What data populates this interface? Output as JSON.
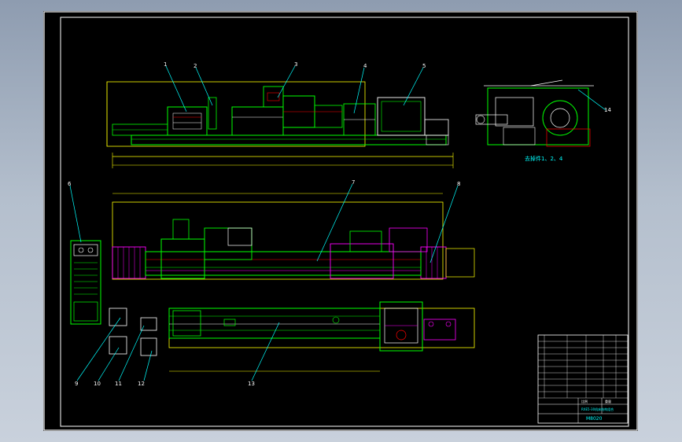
{
  "colors": {
    "background": "#000000",
    "border": "#ffffff",
    "outline": "#ffff00",
    "structure": "#00ff00",
    "secondary": "#ff00ff",
    "leader": "#00ffff",
    "detail": "#ff0000",
    "annotation": "#ffffff"
  },
  "callouts": {
    "c1": "1",
    "c2": "2",
    "c3": "3",
    "c4": "4",
    "c5": "5",
    "c6": "6",
    "c7": "7",
    "c8": "8",
    "c9": "9",
    "c10": "10",
    "c11": "11",
    "c12": "12",
    "c13": "13",
    "c14": "14"
  },
  "side_view_caption": "去掉件1、2、4",
  "title_block": {
    "drawing_number": "M8020",
    "part_name": "RXE5-30机床结构组合",
    "scale_label": "比例",
    "weight_label": "重量"
  }
}
